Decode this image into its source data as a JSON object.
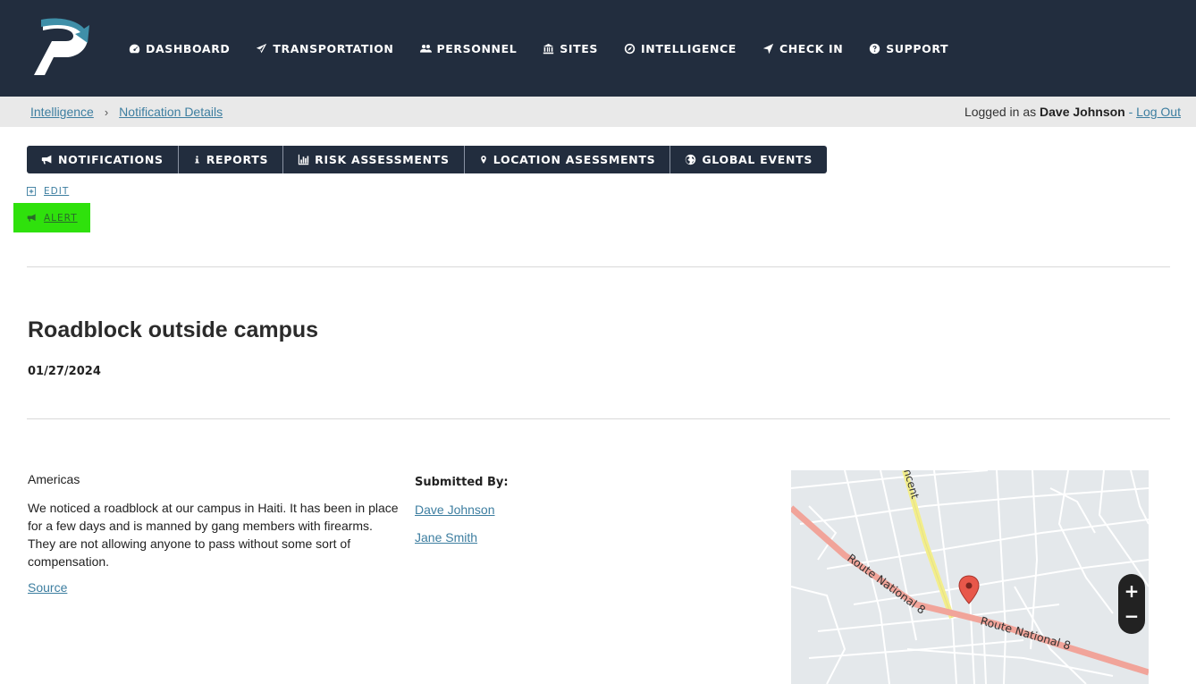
{
  "nav": {
    "items": [
      {
        "label": "DASHBOARD",
        "icon": "dashboard-icon"
      },
      {
        "label": "TRANSPORTATION",
        "icon": "plane-icon"
      },
      {
        "label": "PERSONNEL",
        "icon": "users-icon"
      },
      {
        "label": "SITES",
        "icon": "building-icon"
      },
      {
        "label": "INTELLIGENCE",
        "icon": "compass-icon"
      },
      {
        "label": "CHECK IN",
        "icon": "location-arrow-icon"
      },
      {
        "label": "SUPPORT",
        "icon": "question-icon"
      }
    ]
  },
  "breadcrumb": {
    "items": [
      "Intelligence",
      "Notification Details"
    ],
    "separator": "›"
  },
  "login": {
    "prefix": "Logged in as",
    "user": "Dave Johnson",
    "dash": "-",
    "logout": "Log Out"
  },
  "tabs": [
    {
      "label": "NOTIFICATIONS",
      "icon": "bullhorn-icon"
    },
    {
      "label": "REPORTS",
      "icon": "info-icon"
    },
    {
      "label": "RISK ASSESSMENTS",
      "icon": "bar-chart-icon"
    },
    {
      "label": "LOCATION ASESSMENTS",
      "icon": "map-marker-icon"
    },
    {
      "label": "GLOBAL EVENTS",
      "icon": "globe-icon"
    }
  ],
  "actions": {
    "edit": "EDIT",
    "alert": "ALERT"
  },
  "notification": {
    "title": "Roadblock outside campus",
    "date": "01/27/2024",
    "region": "Americas",
    "description": "We noticed a roadblock at our campus in Haiti. It has been in place for a few days and is manned by gang members with firearms. They are not allowing anyone to pass without some sort of compensation.",
    "source_label": "Source",
    "submitted_by_label": "Submitted By:",
    "submitted_by": [
      "Dave Johnson",
      "Jane Smith"
    ]
  },
  "map": {
    "labels": {
      "road_1": "Route National 8",
      "road_2": "Route National 8",
      "road_3": "ncent"
    },
    "zoom_in": "+",
    "zoom_out": "−",
    "marker_color": "#e8574a"
  },
  "colors": {
    "nav_bg": "#222d3e",
    "link": "#3d7ea0",
    "highlight": "#2fe10c"
  }
}
